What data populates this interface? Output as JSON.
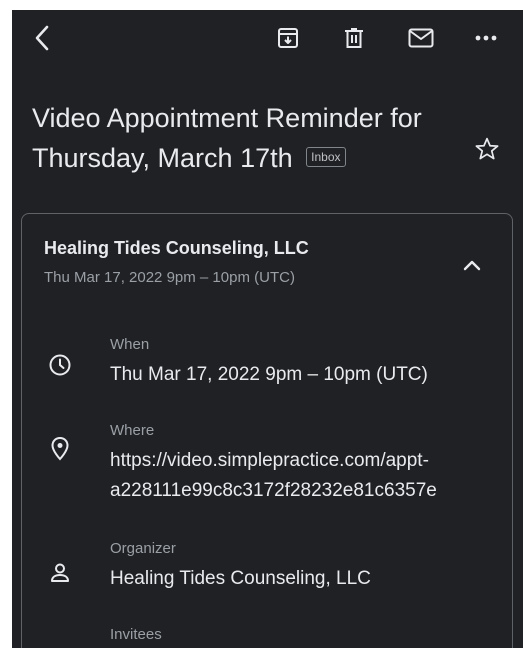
{
  "email": {
    "subject": "Video Appointment Reminder for Thursday, March 17th",
    "label_badge": "Inbox"
  },
  "event": {
    "organizer_name": "Healing Tides Counseling, LLC",
    "summary_time": "Thu Mar 17, 2022 9pm – 10pm (UTC)",
    "details": {
      "when_label": "When",
      "when_value": "Thu Mar 17, 2022 9pm – 10pm (UTC)",
      "where_label": "Where",
      "where_value_line1": "https://video.simplepractice.com/appt-",
      "where_value_line2": "a228111e99c8c3172f28232e81c6357e",
      "organizer_label": "Organizer",
      "organizer_value": "Healing Tides Counseling, LLC",
      "invitees_label": "Invitees"
    }
  },
  "icons": {
    "back": "chevron-left-icon",
    "archive": "archive-icon",
    "delete": "trash-icon",
    "mark_unread": "mail-icon",
    "more": "more-horizontal-icon",
    "star": "star-outline-icon",
    "collapse": "chevron-up-icon",
    "when": "clock-icon",
    "where": "location-pin-icon",
    "organizer": "person-icon",
    "invitees": "people-icon"
  },
  "colors": {
    "background": "#202124",
    "text_primary": "#e8eaed",
    "text_secondary": "#9aa0a6",
    "card_border": "#5f6368"
  }
}
